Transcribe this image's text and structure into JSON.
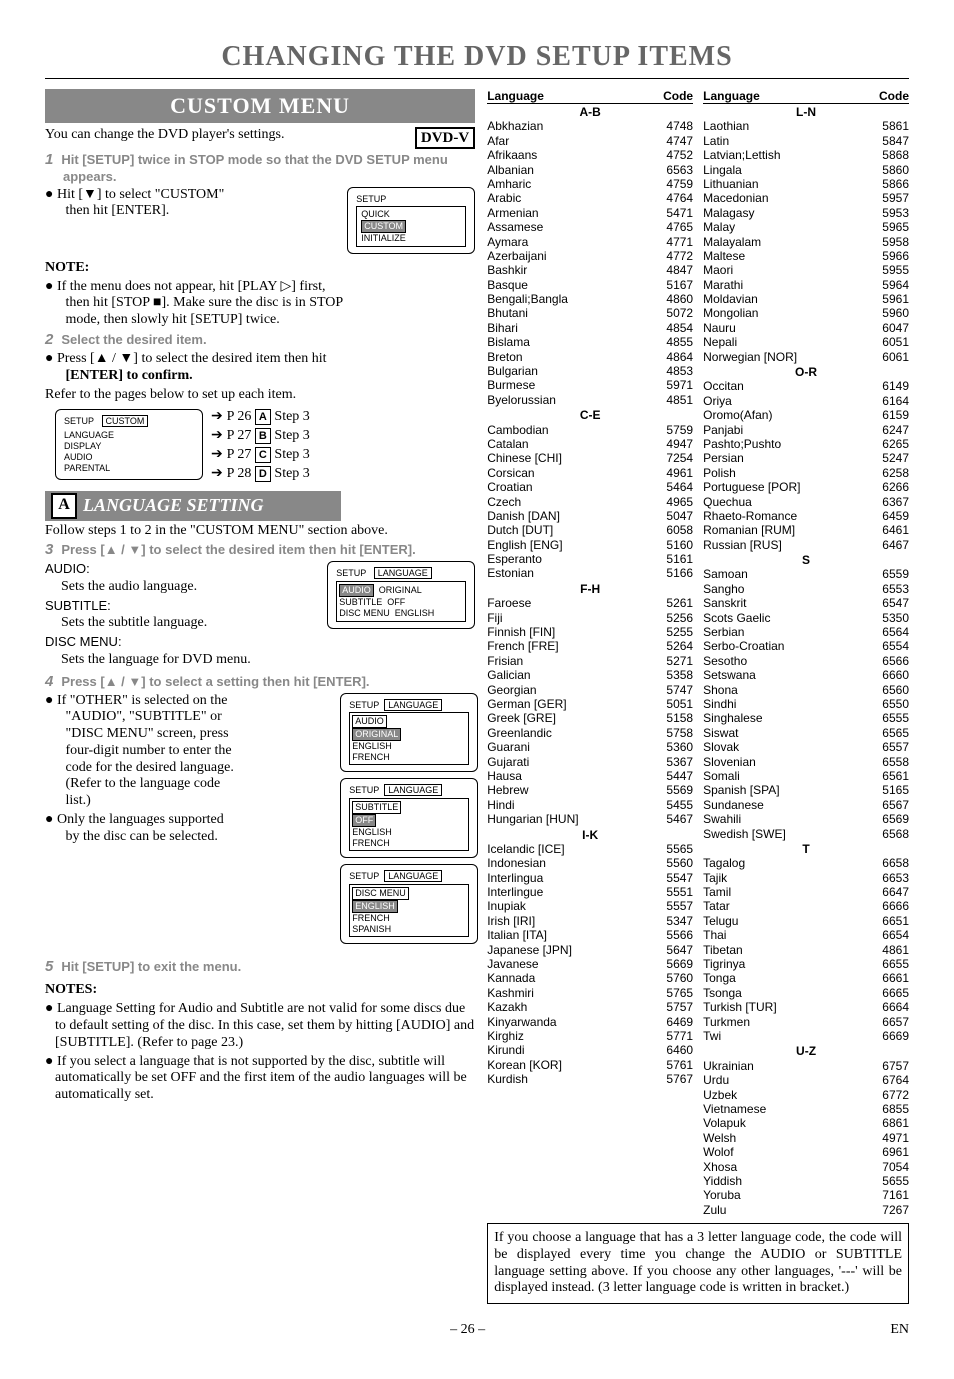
{
  "title": "CHANGING THE DVD SETUP ITEMS",
  "custom_menu_banner": "CUSTOM MENU",
  "dvdv": "DVD-V",
  "intro": "You can change the DVD player's settings.",
  "step1": "Hit [SETUP] twice in STOP mode so that the DVD SETUP menu appears.",
  "hit_custom_1": "Hit [▼] to select \"CUSTOM\"",
  "hit_custom_2": "then hit [ENTER].",
  "setup_menu": {
    "title": "SETUP",
    "items": [
      "QUICK",
      "CUSTOM",
      "INITIALIZE"
    ],
    "hi": 1
  },
  "note_hdr": "NOTE:",
  "note1_a": "If the menu does not appear, hit [PLAY ▷] first,",
  "note1_b": "then hit [STOP ■]. Make sure the disc is in STOP",
  "note1_c": "mode, then slowly hit [SETUP] twice.",
  "step2": "Select the desired item.",
  "press_sel_1": "Press [▲ / ▼] to select the desired item then hit",
  "press_sel_2": "[ENTER] to confirm.",
  "refer": "Refer to the pages below to set up each item.",
  "custom_menu": {
    "title": "SETUP",
    "tab": "CUSTOM",
    "items": [
      "LANGUAGE",
      "DISPLAY",
      "AUDIO",
      "PARENTAL"
    ]
  },
  "refs": [
    {
      "p": "P 26",
      "l": "A",
      "s": "Step 3"
    },
    {
      "p": "P 27",
      "l": "B",
      "s": "Step 3"
    },
    {
      "p": "P 27",
      "l": "C",
      "s": "Step 3"
    },
    {
      "p": "P 28",
      "l": "D",
      "s": "Step 3"
    }
  ],
  "sectA_letter": "A",
  "sectA_title": "LANGUAGE SETTING",
  "follow": "Follow steps 1 to 2 in the \"CUSTOM MENU\" section above.",
  "step3": "Press [▲ / ▼] to select the desired item then hit [ENTER].",
  "audio_hdr": "AUDIO:",
  "audio_sub": "Sets the audio language.",
  "subtitle_hdr": "SUBTITLE:",
  "subtitle_sub": "Sets the subtitle language.",
  "discmenu_hdr": "DISC MENU:",
  "discmenu_sub": "Sets the language for DVD menu.",
  "lang_menu": {
    "title": "SETUP",
    "tab": "LANGUAGE",
    "rows": [
      [
        "AUDIO",
        "ORIGINAL"
      ],
      [
        "SUBTITLE",
        "OFF"
      ],
      [
        "DISC MENU",
        "ENGLISH"
      ]
    ]
  },
  "step4": "Press [▲ / ▼] to select a setting then hit [ENTER].",
  "other_1": "If \"OTHER\" is selected on the",
  "other_2": "\"AUDIO\", \"SUBTITLE\" or",
  "other_3": "\"DISC MENU\" screen, press",
  "other_4": "four-digit number to enter the",
  "other_5": "code for the desired language.",
  "other_6": "(Refer to the language code",
  "other_7": "list.)",
  "only_1": "Only the languages supported",
  "only_2": "by the disc can be selected.",
  "audio_menu": {
    "title": "SETUP",
    "tab": "LANGUAGE",
    "hdr": "AUDIO",
    "items": [
      "ORIGINAL",
      "ENGLISH",
      "FRENCH"
    ]
  },
  "sub_menu": {
    "title": "SETUP",
    "tab": "LANGUAGE",
    "hdr": "SUBTITLE",
    "items": [
      "OFF",
      "ENGLISH",
      "FRENCH"
    ]
  },
  "dm_menu": {
    "title": "SETUP",
    "tab": "LANGUAGE",
    "hdr": "DISC MENU",
    "items": [
      "ENGLISH",
      "FRENCH",
      "SPANISH"
    ]
  },
  "step5": "Hit [SETUP] to exit the menu.",
  "notes_hdr": "NOTES:",
  "noteA": "Language Setting for Audio and Subtitle are not valid for some discs due to default setting of the disc. In this case, set them by hitting [AUDIO] and [SUBTITLE]. (Refer to page 23.)",
  "noteB": "If you select a language that is not supported by the disc, subtitle will automatically be set OFF and the first item of the audio languages will be automatically set.",
  "lh": {
    "lang": "Language",
    "code": "Code"
  },
  "groups_left": [
    {
      "h": "A-B",
      "rows": [
        [
          "Abkhazian",
          "4748"
        ],
        [
          "Afar",
          "4747"
        ],
        [
          "Afrikaans",
          "4752"
        ],
        [
          "Albanian",
          "6563"
        ],
        [
          "Amharic",
          "4759"
        ],
        [
          "Arabic",
          "4764"
        ],
        [
          "Armenian",
          "5471"
        ],
        [
          "Assamese",
          "4765"
        ],
        [
          "Aymara",
          "4771"
        ],
        [
          "Azerbaijani",
          "4772"
        ],
        [
          "Bashkir",
          "4847"
        ],
        [
          "Basque",
          "5167"
        ],
        [
          "Bengali;Bangla",
          "4860"
        ],
        [
          "Bhutani",
          "5072"
        ],
        [
          "Bihari",
          "4854"
        ],
        [
          "Bislama",
          "4855"
        ],
        [
          "Breton",
          "4864"
        ],
        [
          "Bulgarian",
          "4853"
        ],
        [
          "Burmese",
          "5971"
        ],
        [
          "Byelorussian",
          "4851"
        ]
      ]
    },
    {
      "h": "C-E",
      "rows": [
        [
          "Cambodian",
          "5759"
        ],
        [
          "Catalan",
          "4947"
        ],
        [
          "Chinese [CHI]",
          "7254"
        ],
        [
          "Corsican",
          "4961"
        ],
        [
          "Croatian",
          "5464"
        ],
        [
          "Czech",
          "4965"
        ],
        [
          "Danish [DAN]",
          "5047"
        ],
        [
          "Dutch [DUT]",
          "6058"
        ],
        [
          "English [ENG]",
          "5160"
        ],
        [
          "Esperanto",
          "5161"
        ],
        [
          "Estonian",
          "5166"
        ]
      ]
    },
    {
      "h": "F-H",
      "rows": [
        [
          "Faroese",
          "5261"
        ],
        [
          "Fiji",
          "5256"
        ],
        [
          "Finnish [FIN]",
          "5255"
        ],
        [
          "French [FRE]",
          "5264"
        ],
        [
          "Frisian",
          "5271"
        ],
        [
          "Galician",
          "5358"
        ],
        [
          "Georgian",
          "5747"
        ],
        [
          "German [GER]",
          "5051"
        ],
        [
          "Greek [GRE]",
          "5158"
        ],
        [
          "Greenlandic",
          "5758"
        ],
        [
          "Guarani",
          "5360"
        ],
        [
          "Gujarati",
          "5367"
        ],
        [
          "Hausa",
          "5447"
        ],
        [
          "Hebrew",
          "5569"
        ],
        [
          "Hindi",
          "5455"
        ],
        [
          "Hungarian [HUN]",
          "5467"
        ]
      ]
    },
    {
      "h": "I-K",
      "rows": [
        [
          "Icelandic [ICE]",
          "5565"
        ],
        [
          "Indonesian",
          "5560"
        ],
        [
          "Interlingua",
          "5547"
        ],
        [
          "Interlingue",
          "5551"
        ],
        [
          "Inupiak",
          "5557"
        ],
        [
          "Irish [IRI]",
          "5347"
        ],
        [
          "Italian [ITA]",
          "5566"
        ],
        [
          "Japanese [JPN]",
          "5647"
        ],
        [
          "Javanese",
          "5669"
        ],
        [
          "Kannada",
          "5760"
        ],
        [
          "Kashmiri",
          "5765"
        ],
        [
          "Kazakh",
          "5757"
        ],
        [
          "Kinyarwanda",
          "6469"
        ],
        [
          "Kirghiz",
          "5771"
        ],
        [
          "Kirundi",
          "6460"
        ],
        [
          "Korean [KOR]",
          "5761"
        ],
        [
          "Kurdish",
          "5767"
        ]
      ]
    }
  ],
  "groups_right": [
    {
      "h": "L-N",
      "rows": [
        [
          "Laothian",
          "5861"
        ],
        [
          "Latin",
          "5847"
        ],
        [
          "Latvian;Lettish",
          "5868"
        ],
        [
          "Lingala",
          "5860"
        ],
        [
          "Lithuanian",
          "5866"
        ],
        [
          "Macedonian",
          "5957"
        ],
        [
          "Malagasy",
          "5953"
        ],
        [
          "Malay",
          "5965"
        ],
        [
          "Malayalam",
          "5958"
        ],
        [
          "Maltese",
          "5966"
        ],
        [
          "Maori",
          "5955"
        ],
        [
          "Marathi",
          "5964"
        ],
        [
          "Moldavian",
          "5961"
        ],
        [
          "Mongolian",
          "5960"
        ],
        [
          "Nauru",
          "6047"
        ],
        [
          "Nepali",
          "6051"
        ],
        [
          "Norwegian [NOR]",
          "6061"
        ]
      ]
    },
    {
      "h": "O-R",
      "rows": [
        [
          "Occitan",
          "6149"
        ],
        [
          "Oriya",
          "6164"
        ],
        [
          "Oromo(Afan)",
          "6159"
        ],
        [
          "Panjabi",
          "6247"
        ],
        [
          "Pashto;Pushto",
          "6265"
        ],
        [
          "Persian",
          "5247"
        ],
        [
          "Polish",
          "6258"
        ],
        [
          "Portuguese [POR]",
          "6266"
        ],
        [
          "Quechua",
          "6367"
        ],
        [
          "Rhaeto-Romance",
          "6459"
        ],
        [
          "Romanian [RUM]",
          "6461"
        ],
        [
          "Russian [RUS]",
          "6467"
        ]
      ]
    },
    {
      "h": "S",
      "rows": [
        [
          "Samoan",
          "6559"
        ],
        [
          "Sangho",
          "6553"
        ],
        [
          "Sanskrit",
          "6547"
        ],
        [
          "Scots Gaelic",
          "5350"
        ],
        [
          "Serbian",
          "6564"
        ],
        [
          "Serbo-Croatian",
          "6554"
        ],
        [
          "Sesotho",
          "6566"
        ],
        [
          "Setswana",
          "6660"
        ],
        [
          "Shona",
          "6560"
        ],
        [
          "Sindhi",
          "6550"
        ],
        [
          "Singhalese",
          "6555"
        ],
        [
          "Siswat",
          "6565"
        ],
        [
          "Slovak",
          "6557"
        ],
        [
          "Slovenian",
          "6558"
        ],
        [
          "Somali",
          "6561"
        ],
        [
          "Spanish [SPA]",
          "5165"
        ],
        [
          "Sundanese",
          "6567"
        ],
        [
          "Swahili",
          "6569"
        ],
        [
          "Swedish [SWE]",
          "6568"
        ]
      ]
    },
    {
      "h": "T",
      "rows": [
        [
          "Tagalog",
          "6658"
        ],
        [
          "Tajik",
          "6653"
        ],
        [
          "Tamil",
          "6647"
        ],
        [
          "Tatar",
          "6666"
        ],
        [
          "Telugu",
          "6651"
        ],
        [
          "Thai",
          "6654"
        ],
        [
          "Tibetan",
          "4861"
        ],
        [
          "Tigrinya",
          "6655"
        ],
        [
          "Tonga",
          "6661"
        ],
        [
          "Tsonga",
          "6665"
        ],
        [
          "Turkish [TUR]",
          "6664"
        ],
        [
          "Turkmen",
          "6657"
        ],
        [
          "Twi",
          "6669"
        ]
      ]
    },
    {
      "h": "U-Z",
      "rows": [
        [
          "Ukrainian",
          "6757"
        ],
        [
          "Urdu",
          "6764"
        ],
        [
          "Uzbek",
          "6772"
        ],
        [
          "Vietnamese",
          "6855"
        ],
        [
          "Volapuk",
          "6861"
        ],
        [
          "Welsh",
          "4971"
        ],
        [
          "Wolof",
          "6961"
        ],
        [
          "Xhosa",
          "7054"
        ],
        [
          "Yiddish",
          "5655"
        ],
        [
          "Yoruba",
          "7161"
        ],
        [
          "Zulu",
          "7267"
        ]
      ]
    }
  ],
  "bottom_note": "If you choose a language that has a 3 letter language code, the code will be displayed every time you change the AUDIO or SUBTITLE language setting above. If you choose any other languages, '---' will be displayed instead. (3 letter language code is written in bracket.)",
  "page": "– 26 –",
  "page_suffix": "EN"
}
